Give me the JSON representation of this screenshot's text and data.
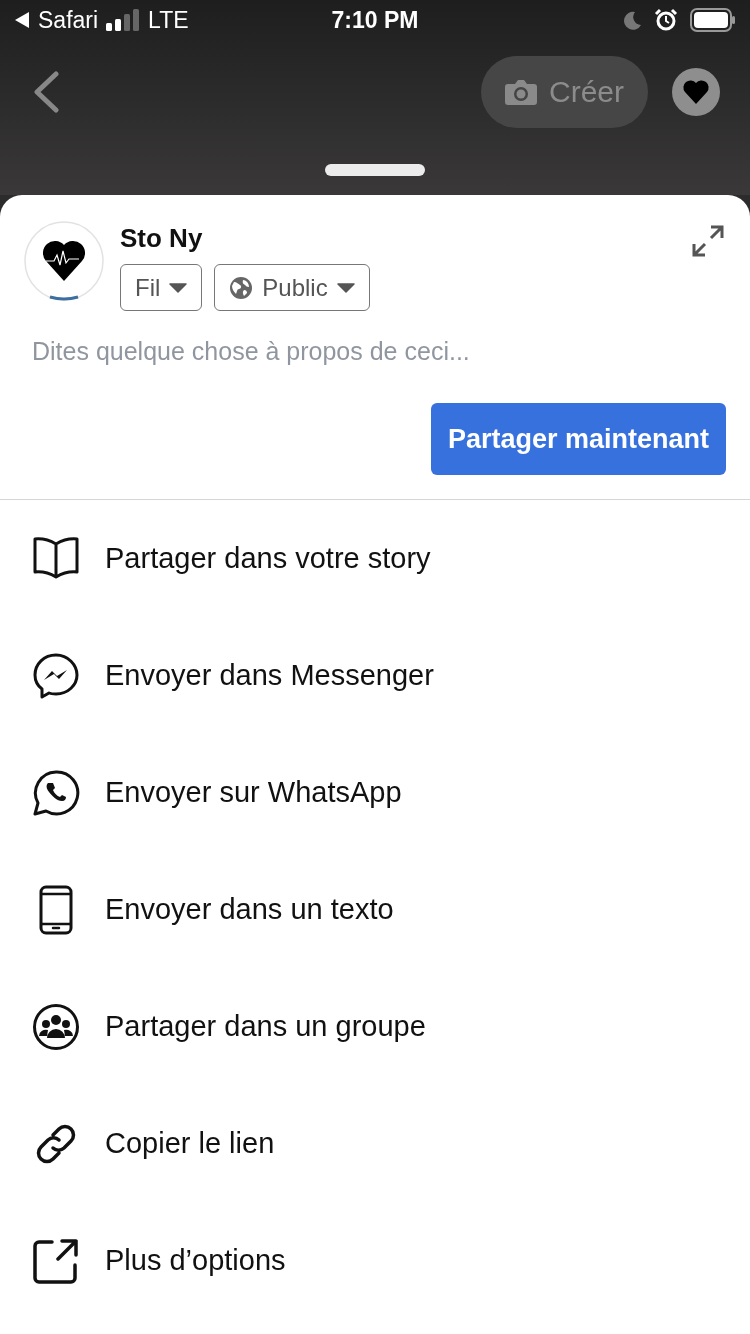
{
  "status_bar": {
    "back_app": "Safari",
    "network": "LTE",
    "time": "7:10 PM"
  },
  "header": {
    "create_button": "Créer"
  },
  "composer": {
    "name": "Sto Ny",
    "audience": [
      {
        "label": "Fil",
        "kind": "feed"
      },
      {
        "label": "Public",
        "kind": "public"
      }
    ],
    "placeholder": "Dites quelque chose à propos de ceci...",
    "share_button": "Partager maintenant"
  },
  "options": [
    {
      "label": "Partager dans votre story",
      "kind": "story"
    },
    {
      "label": "Envoyer dans Messenger",
      "kind": "messenger"
    },
    {
      "label": "Envoyer sur WhatsApp",
      "kind": "whatsapp"
    },
    {
      "label": "Envoyer dans un texto",
      "kind": "sms"
    },
    {
      "label": "Partager dans un groupe",
      "kind": "group"
    },
    {
      "label": "Copier le lien",
      "kind": "link"
    },
    {
      "label": "Plus d’options",
      "kind": "more"
    }
  ]
}
